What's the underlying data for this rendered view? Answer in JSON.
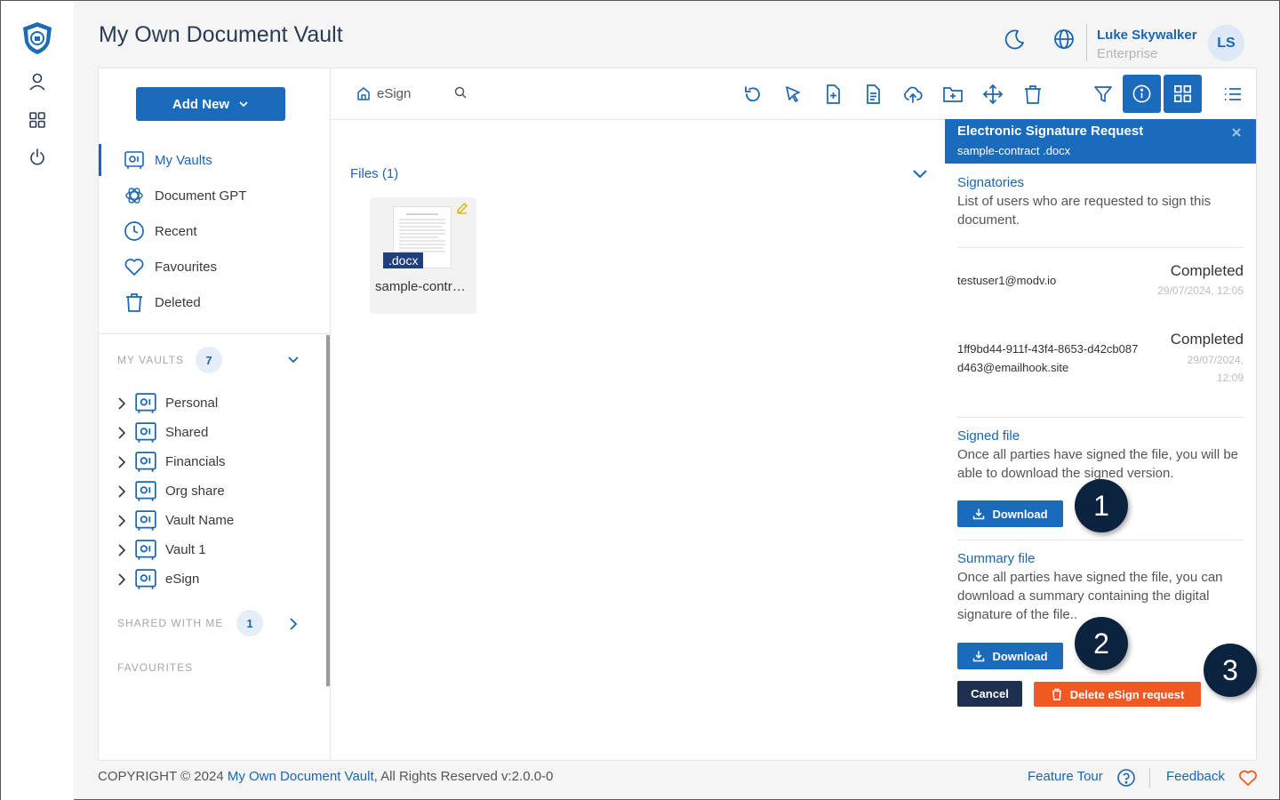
{
  "app": {
    "title": "My Own Document Vault"
  },
  "user": {
    "name": "Luke Skywalker",
    "plan": "Enterprise",
    "initials": "LS"
  },
  "sidebar": {
    "add_new_label": "Add New",
    "nav": [
      {
        "label": "My Vaults",
        "icon": "vault-icon"
      },
      {
        "label": "Document GPT",
        "icon": "openai-icon"
      },
      {
        "label": "Recent",
        "icon": "clock-icon"
      },
      {
        "label": "Favourites",
        "icon": "heart-icon"
      },
      {
        "label": "Deleted",
        "icon": "trash-icon"
      }
    ],
    "my_vaults_label": "MY VAULTS",
    "my_vaults_count": "7",
    "vaults": [
      "Personal",
      "Shared",
      "Financials",
      "Org share",
      "Vault Name",
      "Vault 1",
      "eSign"
    ],
    "shared_label": "SHARED WITH ME",
    "shared_count": "1",
    "favourites_label": "FAVOURITES"
  },
  "toolbar": {
    "breadcrumb": "eSign"
  },
  "files": {
    "header": "Files (1)",
    "items": [
      {
        "ext": ".docx",
        "name": "sample-contract.docx"
      }
    ]
  },
  "esign": {
    "title": "Electronic Signature Request",
    "filename": "sample-contract .docx",
    "signatories_heading": "Signatories",
    "signatories_desc": "List of users who are requested to sign this document.",
    "signatories": [
      {
        "email": "testuser1@modv.io",
        "status": "Completed",
        "date": "29/07/2024, 12:05"
      },
      {
        "email": "1ff9bd44-911f-43f4-8653-d42cb087d463@emailhook.site",
        "status": "Completed",
        "date": "29/07/2024, 12:09"
      }
    ],
    "signed_heading": "Signed file",
    "signed_desc": "Once all parties have signed the file, you will be able to download the signed version.",
    "summary_heading": "Summary file",
    "summary_desc": "Once all parties have signed the file, you can download a summary containing the digital signature of the file..",
    "download_label": "Download",
    "cancel_label": "Cancel",
    "delete_label": "Delete eSign request"
  },
  "callouts": [
    "1",
    "2",
    "3"
  ],
  "footer": {
    "copyright": "COPYRIGHT © 2024",
    "brand": "My Own Document Vault",
    "rights": ", All Rights Reserved v:2.0.0-0",
    "feature_tour": "Feature Tour",
    "feedback": "Feedback"
  },
  "colors": {
    "primary": "#1a6bbc",
    "navy": "#0c2340",
    "danger": "#f05a22"
  }
}
